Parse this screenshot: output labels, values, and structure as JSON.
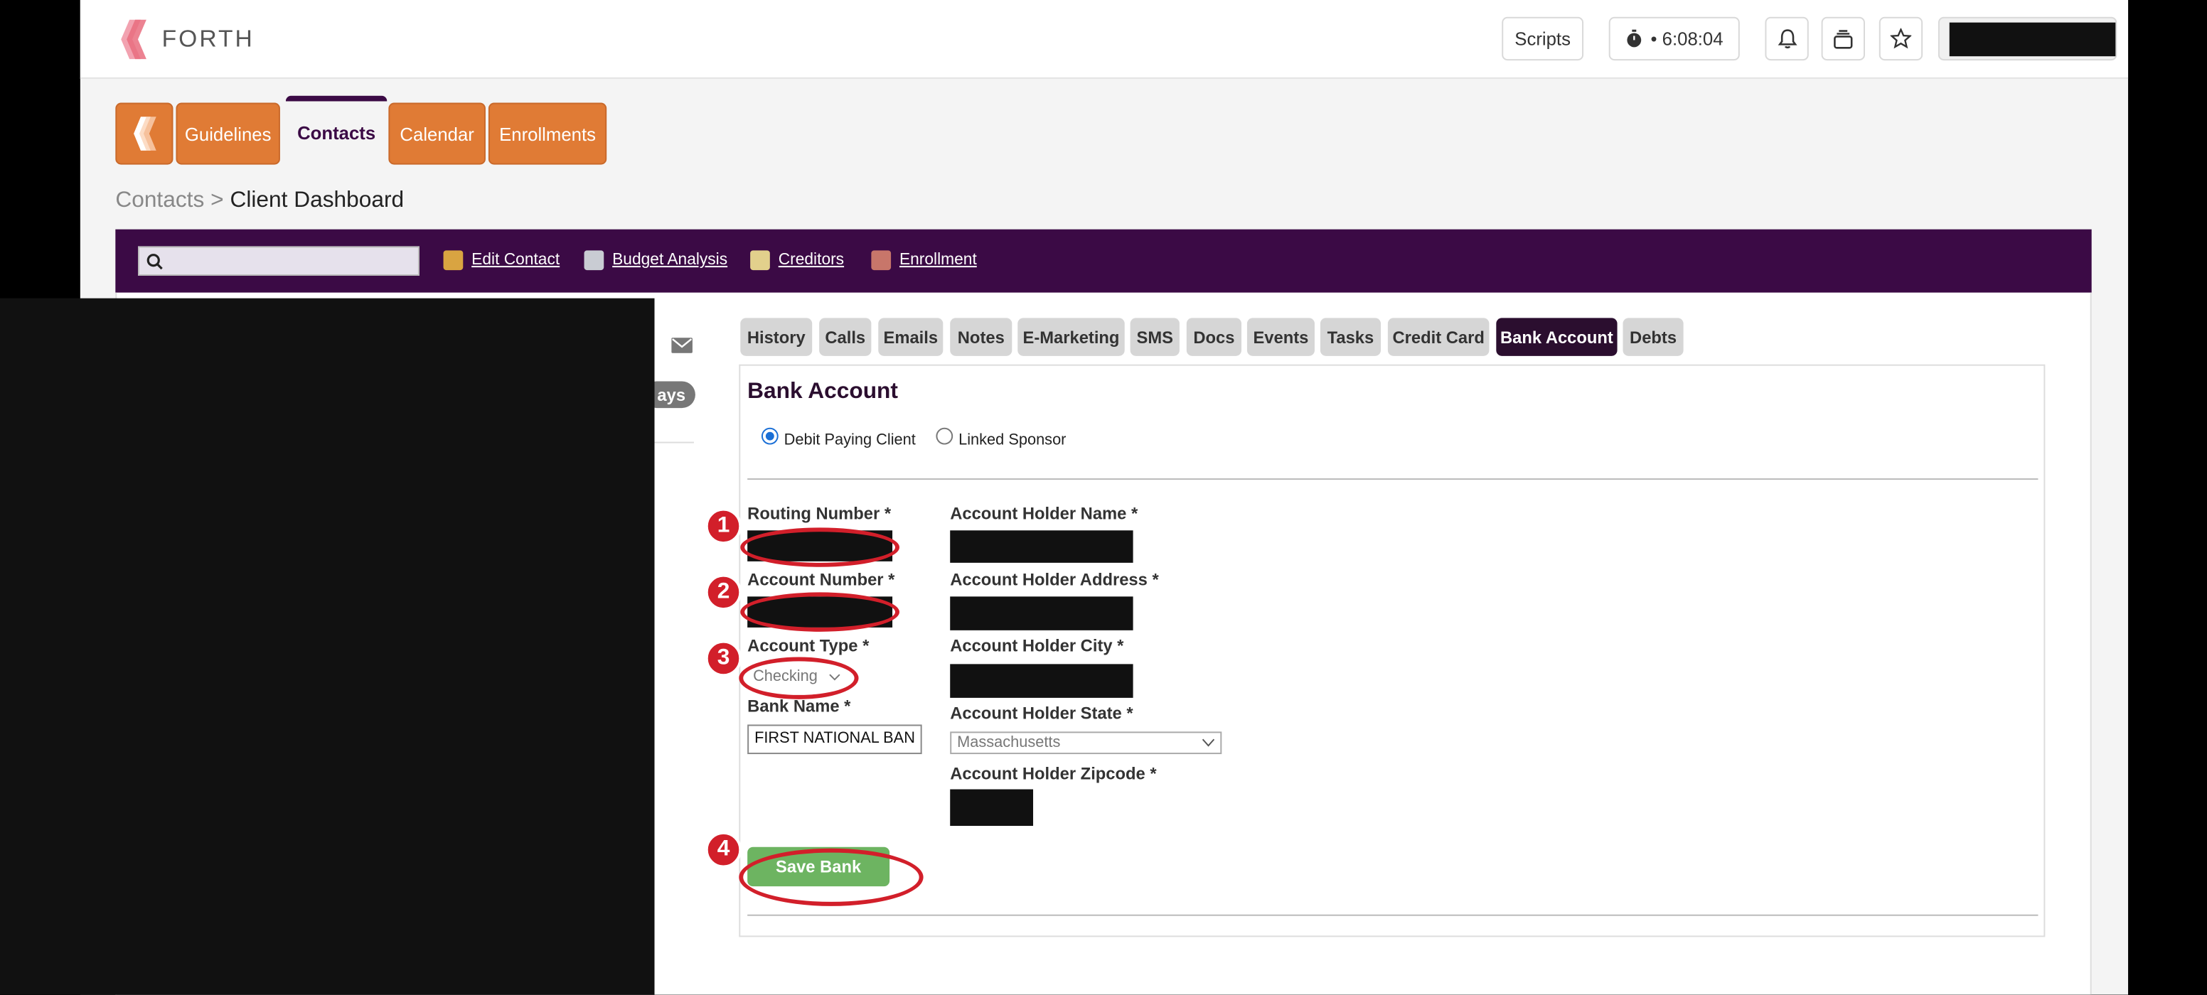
{
  "header": {
    "logo_text": "FORTH",
    "scripts_label": "Scripts",
    "timer": "• 6:08:04"
  },
  "nav": {
    "tabs": [
      {
        "label": "Guidelines"
      },
      {
        "label": "Contacts",
        "active": true
      },
      {
        "label": "Calendar"
      },
      {
        "label": "Enrollments"
      }
    ]
  },
  "breadcrumb": {
    "parent": "Contacts",
    "separator": ">",
    "current": "Client Dashboard"
  },
  "toolbar": {
    "links": [
      {
        "label": "Edit Contact",
        "icon": "edit-contact-icon"
      },
      {
        "label": "Budget Analysis",
        "icon": "calculator-icon"
      },
      {
        "label": "Creditors",
        "icon": "pencil-note-icon"
      },
      {
        "label": "Enrollment",
        "icon": "books-icon"
      }
    ]
  },
  "sidebar": {
    "badge_partial": "ays"
  },
  "subtabs": [
    {
      "label": "History"
    },
    {
      "label": "Calls"
    },
    {
      "label": "Emails"
    },
    {
      "label": "Notes"
    },
    {
      "label": "E-Marketing"
    },
    {
      "label": "SMS"
    },
    {
      "label": "Docs"
    },
    {
      "label": "Events"
    },
    {
      "label": "Tasks"
    },
    {
      "label": "Credit Card"
    },
    {
      "label": "Bank Account",
      "active": true
    },
    {
      "label": "Debts"
    }
  ],
  "bank": {
    "title": "Bank Account",
    "radio_options": [
      {
        "label": "Debit Paying Client",
        "selected": true
      },
      {
        "label": "Linked Sponsor",
        "selected": false
      }
    ],
    "routing_label": "Routing Number *",
    "account_number_label": "Account Number *",
    "account_type_label": "Account Type *",
    "account_type_value": "Checking",
    "bank_name_label": "Bank Name *",
    "bank_name_value": "FIRST NATIONAL BAN",
    "holder_name_label": "Account Holder Name *",
    "holder_address_label": "Account Holder Address *",
    "holder_city_label": "Account Holder City *",
    "holder_state_label": "Account Holder State *",
    "holder_state_value": "Massachusetts",
    "holder_zip_label": "Account Holder Zipcode *",
    "save_label": "Save Bank"
  },
  "annotations": {
    "markers": [
      "1",
      "2",
      "3",
      "4"
    ],
    "color": "#d21f2a"
  },
  "colors": {
    "brand_orange": "#e07b35",
    "brand_purple": "#3b0a45",
    "save_green": "#6db461"
  }
}
